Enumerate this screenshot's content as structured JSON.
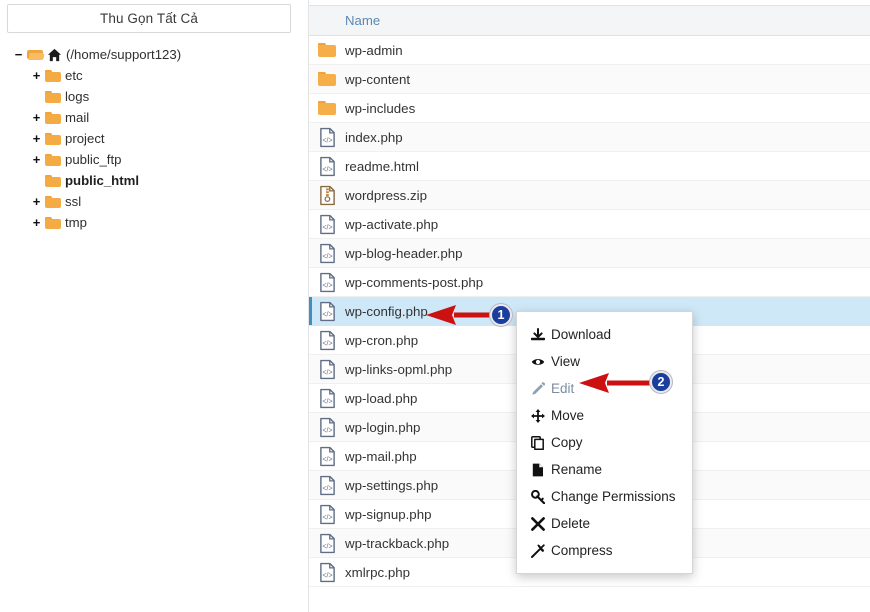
{
  "sidebar": {
    "collapse_all_label": "Thu Gọn Tất Cả",
    "tree": [
      {
        "label": "(/home/support123)",
        "toggle": "−",
        "icon": "folder-open-home-icon",
        "indent": 0,
        "bold": false
      },
      {
        "label": "etc",
        "toggle": "+",
        "icon": "folder-icon",
        "indent": 1,
        "bold": false
      },
      {
        "label": "logs",
        "toggle": "",
        "icon": "folder-icon",
        "indent": 1,
        "bold": false
      },
      {
        "label": "mail",
        "toggle": "+",
        "icon": "folder-icon",
        "indent": 1,
        "bold": false
      },
      {
        "label": "project",
        "toggle": "+",
        "icon": "folder-icon",
        "indent": 1,
        "bold": false
      },
      {
        "label": "public_ftp",
        "toggle": "+",
        "icon": "folder-icon",
        "indent": 1,
        "bold": false
      },
      {
        "label": "public_html",
        "toggle": "",
        "icon": "folder-icon",
        "indent": 1,
        "bold": true
      },
      {
        "label": "ssl",
        "toggle": "+",
        "icon": "folder-icon",
        "indent": 1,
        "bold": false
      },
      {
        "label": "tmp",
        "toggle": "+",
        "icon": "folder-icon",
        "indent": 1,
        "bold": false
      }
    ]
  },
  "file_list": {
    "column_header": "Name",
    "rows": [
      {
        "name": "wp-admin",
        "type": "folder",
        "selected": false
      },
      {
        "name": "wp-content",
        "type": "folder",
        "selected": false
      },
      {
        "name": "wp-includes",
        "type": "folder",
        "selected": false
      },
      {
        "name": "index.php",
        "type": "code",
        "selected": false
      },
      {
        "name": "readme.html",
        "type": "code",
        "selected": false
      },
      {
        "name": "wordpress.zip",
        "type": "archive",
        "selected": false
      },
      {
        "name": "wp-activate.php",
        "type": "code",
        "selected": false
      },
      {
        "name": "wp-blog-header.php",
        "type": "code",
        "selected": false
      },
      {
        "name": "wp-comments-post.php",
        "type": "code",
        "selected": false
      },
      {
        "name": "wp-config.php",
        "type": "code",
        "selected": true
      },
      {
        "name": "wp-cron.php",
        "type": "code",
        "selected": false
      },
      {
        "name": "wp-links-opml.php",
        "type": "code",
        "selected": false
      },
      {
        "name": "wp-load.php",
        "type": "code",
        "selected": false
      },
      {
        "name": "wp-login.php",
        "type": "code",
        "selected": false
      },
      {
        "name": "wp-mail.php",
        "type": "code",
        "selected": false
      },
      {
        "name": "wp-settings.php",
        "type": "code",
        "selected": false
      },
      {
        "name": "wp-signup.php",
        "type": "code",
        "selected": false
      },
      {
        "name": "wp-trackback.php",
        "type": "code",
        "selected": false
      },
      {
        "name": "xmlrpc.php",
        "type": "code",
        "selected": false
      }
    ]
  },
  "context_menu": {
    "items": [
      {
        "label": "Download",
        "icon": "download-icon",
        "dim": false
      },
      {
        "label": "View",
        "icon": "eye-icon",
        "dim": false
      },
      {
        "label": "Edit",
        "icon": "pencil-icon",
        "dim": true
      },
      {
        "label": "Move",
        "icon": "move-arrows-icon",
        "dim": false
      },
      {
        "label": "Copy",
        "icon": "copy-icon",
        "dim": false
      },
      {
        "label": "Rename",
        "icon": "file-icon",
        "dim": false
      },
      {
        "label": "Change Permissions",
        "icon": "key-icon",
        "dim": false
      },
      {
        "label": "Delete",
        "icon": "x-mark-icon",
        "dim": false
      },
      {
        "label": "Compress",
        "icon": "compress-icon",
        "dim": false
      }
    ]
  },
  "annotations": {
    "badges": [
      {
        "number": "1"
      },
      {
        "number": "2"
      }
    ],
    "arrow_color": "#cc1111",
    "badge_color": "#1b3d9b"
  }
}
